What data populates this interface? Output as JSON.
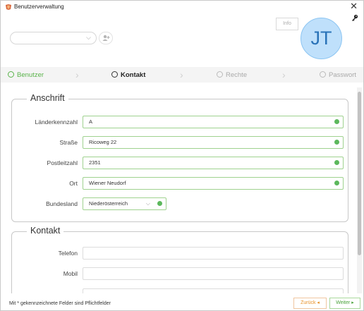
{
  "window": {
    "title": "Benutzerverwaltung",
    "close_glyph": "✕"
  },
  "top": {
    "info_label": "Info",
    "avatar_initials": "JT",
    "user_select_value": ""
  },
  "stepper": {
    "steps": [
      {
        "label": "Benutzer",
        "state": "done"
      },
      {
        "label": "Kontakt",
        "state": "active"
      },
      {
        "label": "Rechte",
        "state": "pending"
      },
      {
        "label": "Passwort",
        "state": "pending"
      }
    ]
  },
  "anschrift": {
    "title": "Anschrift",
    "fields": [
      {
        "label": "Länderkennzahl",
        "value": "A"
      },
      {
        "label": "Straße",
        "value": "Ricoweg 22"
      },
      {
        "label": "Postleitzahl",
        "value": "2351"
      },
      {
        "label": "Ort",
        "value": "Wiener Neudorf"
      },
      {
        "label": "Bundesland",
        "value": "Niederösterreich"
      }
    ]
  },
  "kontakt": {
    "title": "Kontakt",
    "fields": [
      {
        "label": "Telefon",
        "value": ""
      },
      {
        "label": "Mobil",
        "value": ""
      }
    ]
  },
  "footer": {
    "note": "Mit * gekennzeichnete Felder sind Pflichtfelder",
    "back_label": "Zurück ◂",
    "next_label": "Weiter ▸"
  },
  "colors": {
    "success": "#5cb85c",
    "avatar_bg": "#bfe0fb",
    "avatar_text": "#2a73b8",
    "back": "#e8932c",
    "next": "#4aa33a"
  },
  "icons": [
    "app-icon",
    "close-icon",
    "key-icon",
    "chevron-down-icon",
    "add-user-icon",
    "check-icon"
  ]
}
